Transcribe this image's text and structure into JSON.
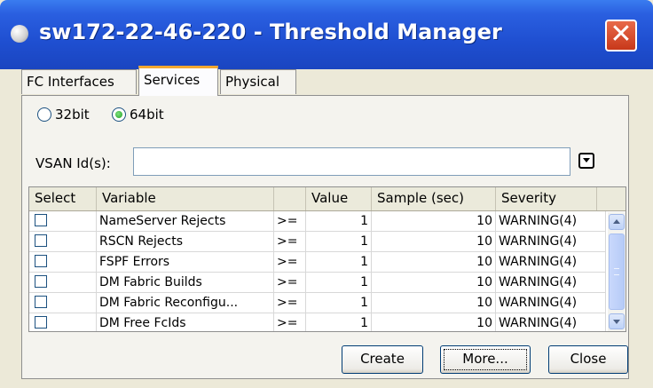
{
  "window": {
    "title": "sw172-22-46-220 - Threshold Manager",
    "close_glyph": "✕"
  },
  "tabs": [
    {
      "label": "FC Interfaces",
      "active": false
    },
    {
      "label": "Services",
      "active": true
    },
    {
      "label": "Physical",
      "active": false
    }
  ],
  "radios": [
    {
      "label": "32bit",
      "selected": false
    },
    {
      "label": "64bit",
      "selected": true
    }
  ],
  "vsan": {
    "label": "VSAN Id(s):",
    "value": ""
  },
  "table": {
    "columns": [
      "Select",
      "Variable",
      "",
      "Value",
      "Sample (sec)",
      "Severity"
    ],
    "rows": [
      {
        "variable": "NameServer Rejects",
        "op": ">=",
        "value": "1",
        "sample": "10",
        "severity": "WARNING(4)"
      },
      {
        "variable": "RSCN Rejects",
        "op": ">=",
        "value": "1",
        "sample": "10",
        "severity": "WARNING(4)"
      },
      {
        "variable": "FSPF Errors",
        "op": ">=",
        "value": "1",
        "sample": "10",
        "severity": "WARNING(4)"
      },
      {
        "variable": "DM Fabric Builds",
        "op": ">=",
        "value": "1",
        "sample": "10",
        "severity": "WARNING(4)"
      },
      {
        "variable": "DM Fabric Reconfigu...",
        "op": ">=",
        "value": "1",
        "sample": "10",
        "severity": "WARNING(4)"
      },
      {
        "variable": "DM Free FcIds",
        "op": ">=",
        "value": "1",
        "sample": "10",
        "severity": "WARNING(4)"
      }
    ]
  },
  "buttons": {
    "create": "Create",
    "more": "More...",
    "close": "Close"
  }
}
